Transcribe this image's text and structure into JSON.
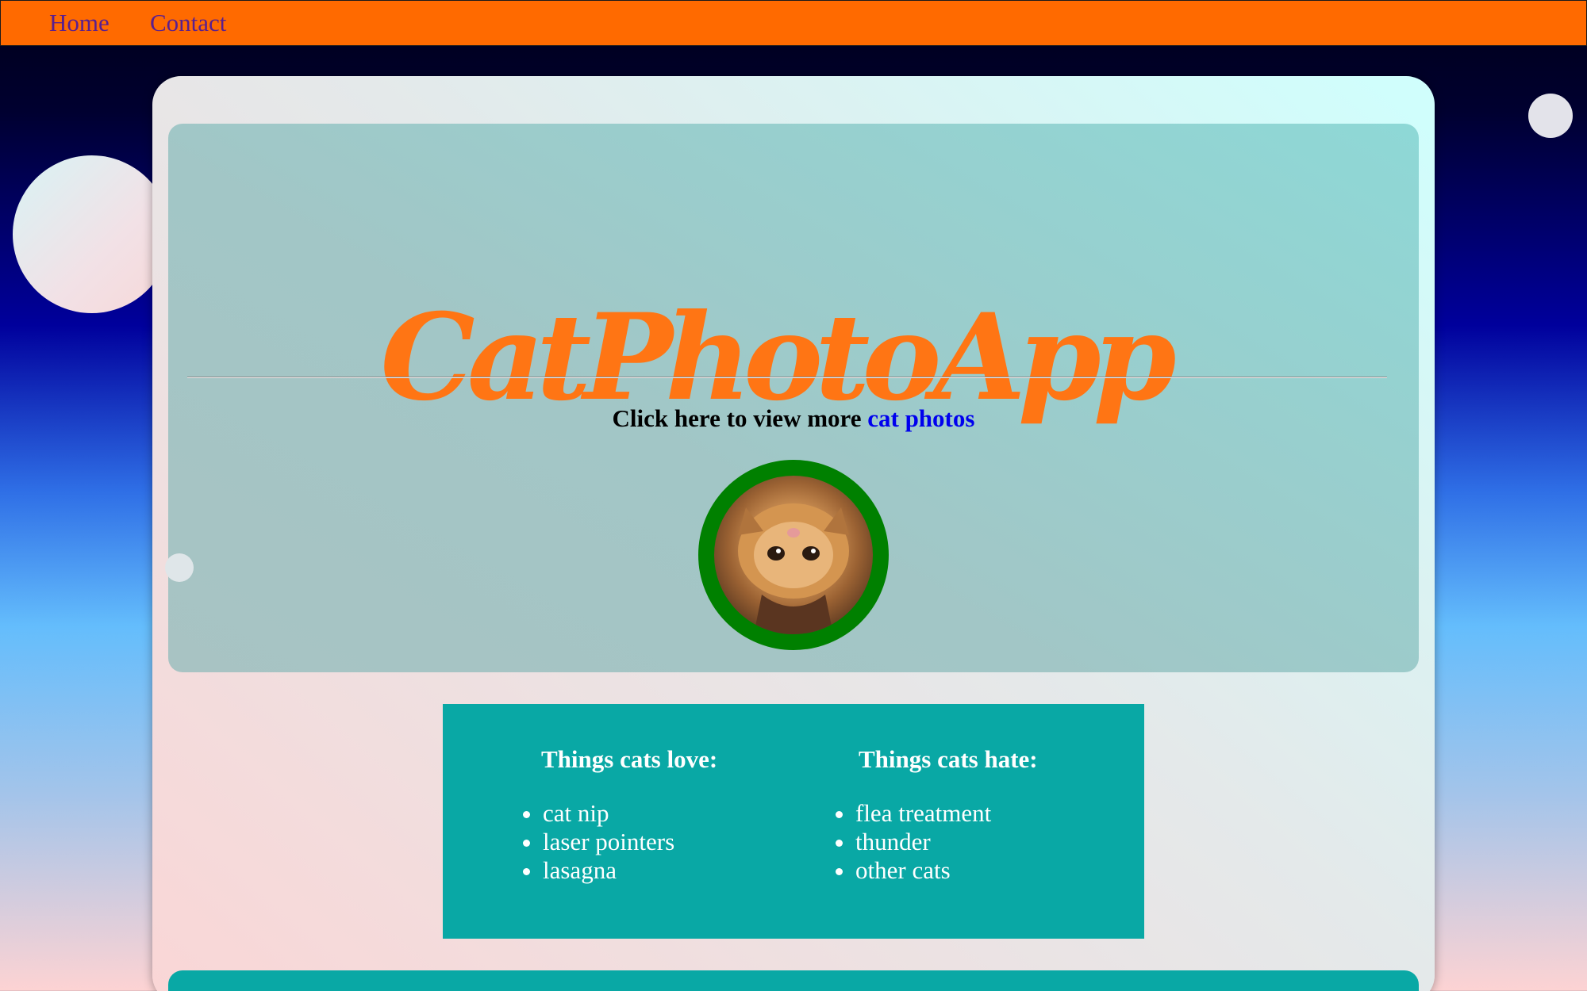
{
  "nav": {
    "items": [
      {
        "label": "Home"
      },
      {
        "label": "Contact"
      }
    ]
  },
  "header": {
    "title": "CatPhotoApp",
    "prompt_text": "Click here to view more ",
    "link_text": "cat photos"
  },
  "lists": {
    "love": {
      "heading": "Things cats love:",
      "items": [
        "cat nip",
        "laser pointers",
        "lasagna"
      ]
    },
    "hate": {
      "heading": "Things cats hate:",
      "items": [
        "flea treatment",
        "thunder",
        "other cats"
      ]
    }
  },
  "colors": {
    "navbar": "#ff6a00",
    "title": "#ff7514",
    "link": "#0000ee",
    "photo_border": "#008000",
    "lists_panel": "#09a8a5"
  },
  "icons": {
    "cat_photo": "kitten-photo"
  }
}
